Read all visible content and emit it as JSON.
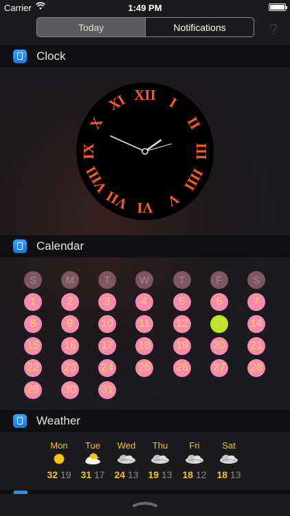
{
  "status_bar": {
    "carrier": "Carrier",
    "time": "1:49 PM"
  },
  "segmented": {
    "today": "Today",
    "notifications": "Notifications"
  },
  "help_label": "?",
  "sections": {
    "clock": "Clock",
    "calendar": "Calendar",
    "weather": "Weather"
  },
  "clock": {
    "numerals": [
      "XII",
      "I",
      "II",
      "III",
      "IIII",
      "V",
      "VI",
      "VII",
      "VIII",
      "IX",
      "X",
      "XI"
    ],
    "numeral_color": "#ff5a1f",
    "face_color": "#000000",
    "hour": 1,
    "minute": 49
  },
  "calendar": {
    "weekdays": [
      "S",
      "M",
      "T",
      "W",
      "T",
      "F",
      "S"
    ],
    "days": [
      1,
      2,
      3,
      4,
      5,
      6,
      7,
      8,
      9,
      10,
      11,
      12,
      13,
      14,
      15,
      16,
      17,
      18,
      19,
      20,
      21,
      22,
      23,
      24,
      25,
      26,
      27,
      28,
      29,
      30,
      31
    ],
    "today": 13,
    "colors": {
      "day_bg": "#f78ab0",
      "today_bg": "#b8e820",
      "number": "#f2d25c",
      "header_bg": "#7e5762"
    }
  },
  "weather": {
    "days": [
      {
        "name": "Mon",
        "icon": "sun-icon",
        "hi": "32",
        "lo": "19"
      },
      {
        "name": "Tue",
        "icon": "partly-cloudy-icon",
        "hi": "31",
        "lo": "17"
      },
      {
        "name": "Wed",
        "icon": "cloud-icon",
        "hi": "24",
        "lo": "13"
      },
      {
        "name": "Thu",
        "icon": "cloud-icon",
        "hi": "19",
        "lo": "13"
      },
      {
        "name": "Fri",
        "icon": "cloud-icon",
        "hi": "18",
        "lo": "12"
      },
      {
        "name": "Sat",
        "icon": "cloud-icon",
        "hi": "18",
        "lo": "13"
      }
    ]
  }
}
